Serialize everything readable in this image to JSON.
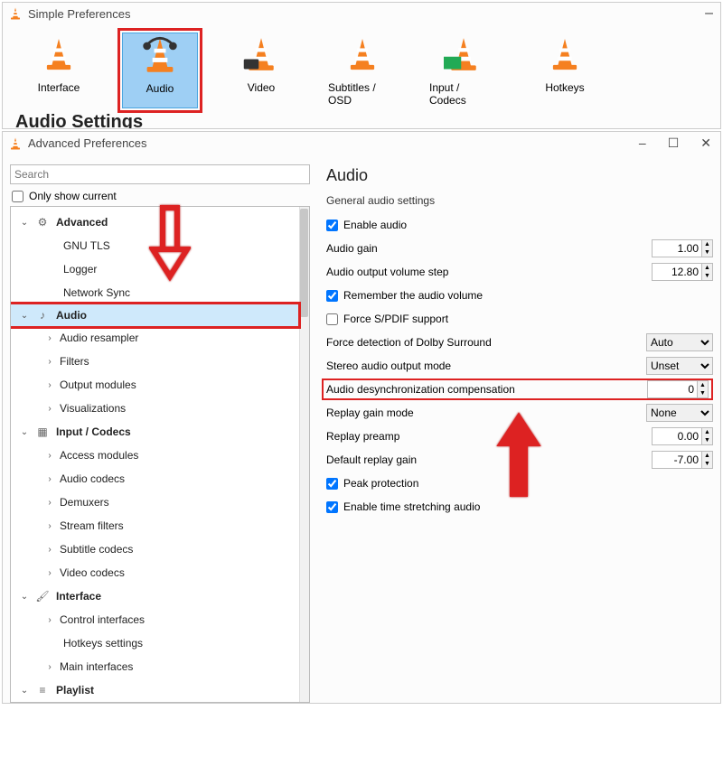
{
  "simple": {
    "title": "Simple Preferences",
    "items": [
      {
        "label": "Interface"
      },
      {
        "label": "Audio"
      },
      {
        "label": "Video"
      },
      {
        "label": "Subtitles / OSD"
      },
      {
        "label": "Input / Codecs"
      },
      {
        "label": "Hotkeys"
      }
    ],
    "cutoff_heading": "Audio Settings"
  },
  "advanced": {
    "title": "Advanced Preferences",
    "search_placeholder": "Search",
    "only_show_label": "Only show current",
    "tree": {
      "advanced": "Advanced",
      "gnu_tls": "GNU TLS",
      "logger": "Logger",
      "network_sync": "Network Sync",
      "audio": "Audio",
      "audio_resampler": "Audio resampler",
      "filters": "Filters",
      "output_modules": "Output modules",
      "visualizations": "Visualizations",
      "input_codecs": "Input / Codecs",
      "access_modules": "Access modules",
      "audio_codecs": "Audio codecs",
      "demuxers": "Demuxers",
      "stream_filters": "Stream filters",
      "subtitle_codecs": "Subtitle codecs",
      "video_codecs": "Video codecs",
      "interface": "Interface",
      "control_interfaces": "Control interfaces",
      "hotkeys_settings": "Hotkeys settings",
      "main_interfaces": "Main interfaces",
      "playlist": "Playlist"
    }
  },
  "panel": {
    "heading": "Audio",
    "subheading": "General audio settings",
    "enable_audio": "Enable audio",
    "audio_gain": "Audio gain",
    "audio_gain_val": "1.00",
    "volume_step": "Audio output volume step",
    "volume_step_val": "12.80",
    "remember_volume": "Remember the audio volume",
    "force_spdif": "Force S/PDIF support",
    "dolby": "Force detection of Dolby Surround",
    "dolby_val": "Auto",
    "stereo_mode": "Stereo audio output mode",
    "stereo_mode_val": "Unset",
    "desync": "Audio desynchronization compensation",
    "desync_val": "0",
    "replay_mode": "Replay gain mode",
    "replay_mode_val": "None",
    "replay_preamp": "Replay preamp",
    "replay_preamp_val": "0.00",
    "default_replay": "Default replay gain",
    "default_replay_val": "-7.00",
    "peak_protection": "Peak protection",
    "time_stretch": "Enable time stretching audio"
  }
}
